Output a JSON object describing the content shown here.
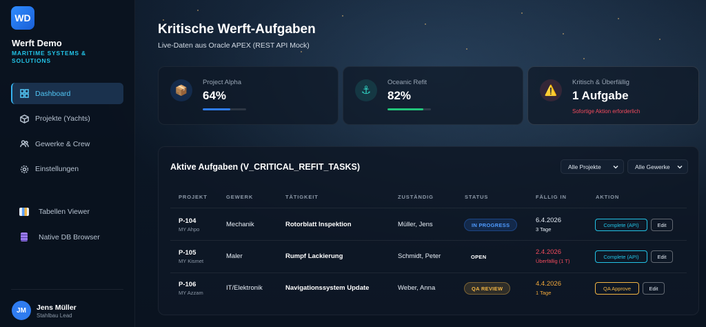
{
  "brand": {
    "initials": "WD",
    "title": "Werft Demo",
    "subtitle": "MARITIME SYSTEMS & SOLUTIONS"
  },
  "nav": {
    "main": [
      {
        "label": "Dashboard",
        "icon": "grid-icon",
        "active": true
      },
      {
        "label": "Projekte (Yachts)",
        "icon": "cube-icon",
        "active": false
      },
      {
        "label": "Gewerke & Crew",
        "icon": "users-icon",
        "active": false
      },
      {
        "label": "Einstellungen",
        "icon": "gear-icon",
        "active": false
      }
    ],
    "tools": [
      {
        "label": "Tabellen Viewer",
        "icon": "chart-icon"
      },
      {
        "label": "Native DB Browser",
        "icon": "database-icon"
      }
    ]
  },
  "user": {
    "initials": "JM",
    "name": "Jens Müller",
    "role": "Stahlbau Lead"
  },
  "header": {
    "title": "Kritische Werft-Aufgaben",
    "subtitle": "Live-Daten aus Oracle APEX (REST API Mock)"
  },
  "stats": [
    {
      "label": "Project Alpha",
      "value": "64%",
      "progress": 0.64,
      "icon": "package-icon",
      "color": "#2f7cf0"
    },
    {
      "label": "Oceanic Refit",
      "value": "82%",
      "progress": 0.82,
      "icon": "anchor-icon",
      "color": "#22c47a"
    },
    {
      "label": "Kritisch & Überfällig",
      "value": "1 Aufgabe",
      "alert": "Sofortige Aktion erforderlich",
      "icon": "warning-icon",
      "color": "#f24b5d"
    }
  ],
  "tasks": {
    "title": "Aktive Aufgaben (V_CRITICAL_REFIT_TASKS)",
    "filters": {
      "projects": "Alle Projekte",
      "trades": "Alle Gewerke"
    },
    "columns": [
      "PROJEKT",
      "GEWERK",
      "TÄTIGKEIT",
      "ZUSTÄNDIG",
      "STATUS",
      "FÄLLIG IN",
      "AKTION"
    ],
    "rows": [
      {
        "project": "P-104",
        "yacht": "MY Ahpo",
        "trade": "Mechanik",
        "activity": "Rotorblatt Inspektion",
        "owner": "Müller, Jens",
        "status": "IN PROGRESS",
        "due_date": "6.4.2026",
        "due_note": "3 Tage",
        "action": "Complete (API)",
        "edit": "Edit"
      },
      {
        "project": "P-105",
        "yacht": "MY Kismet",
        "trade": "Maler",
        "activity": "Rumpf Lackierung",
        "owner": "Schmidt, Peter",
        "status": "OPEN",
        "due_date": "2.4.2026",
        "due_note": "Überfällig (1 T)",
        "action": "Complete (API)",
        "edit": "Edit"
      },
      {
        "project": "P-106",
        "yacht": "MY Azzam",
        "trade": "IT/Elektronik",
        "activity": "Navigationssystem Update",
        "owner": "Weber, Anna",
        "status": "QA REVIEW",
        "due_date": "4.4.2026",
        "due_note": "1 Tage",
        "action": "QA Approve",
        "edit": "Edit"
      }
    ]
  }
}
